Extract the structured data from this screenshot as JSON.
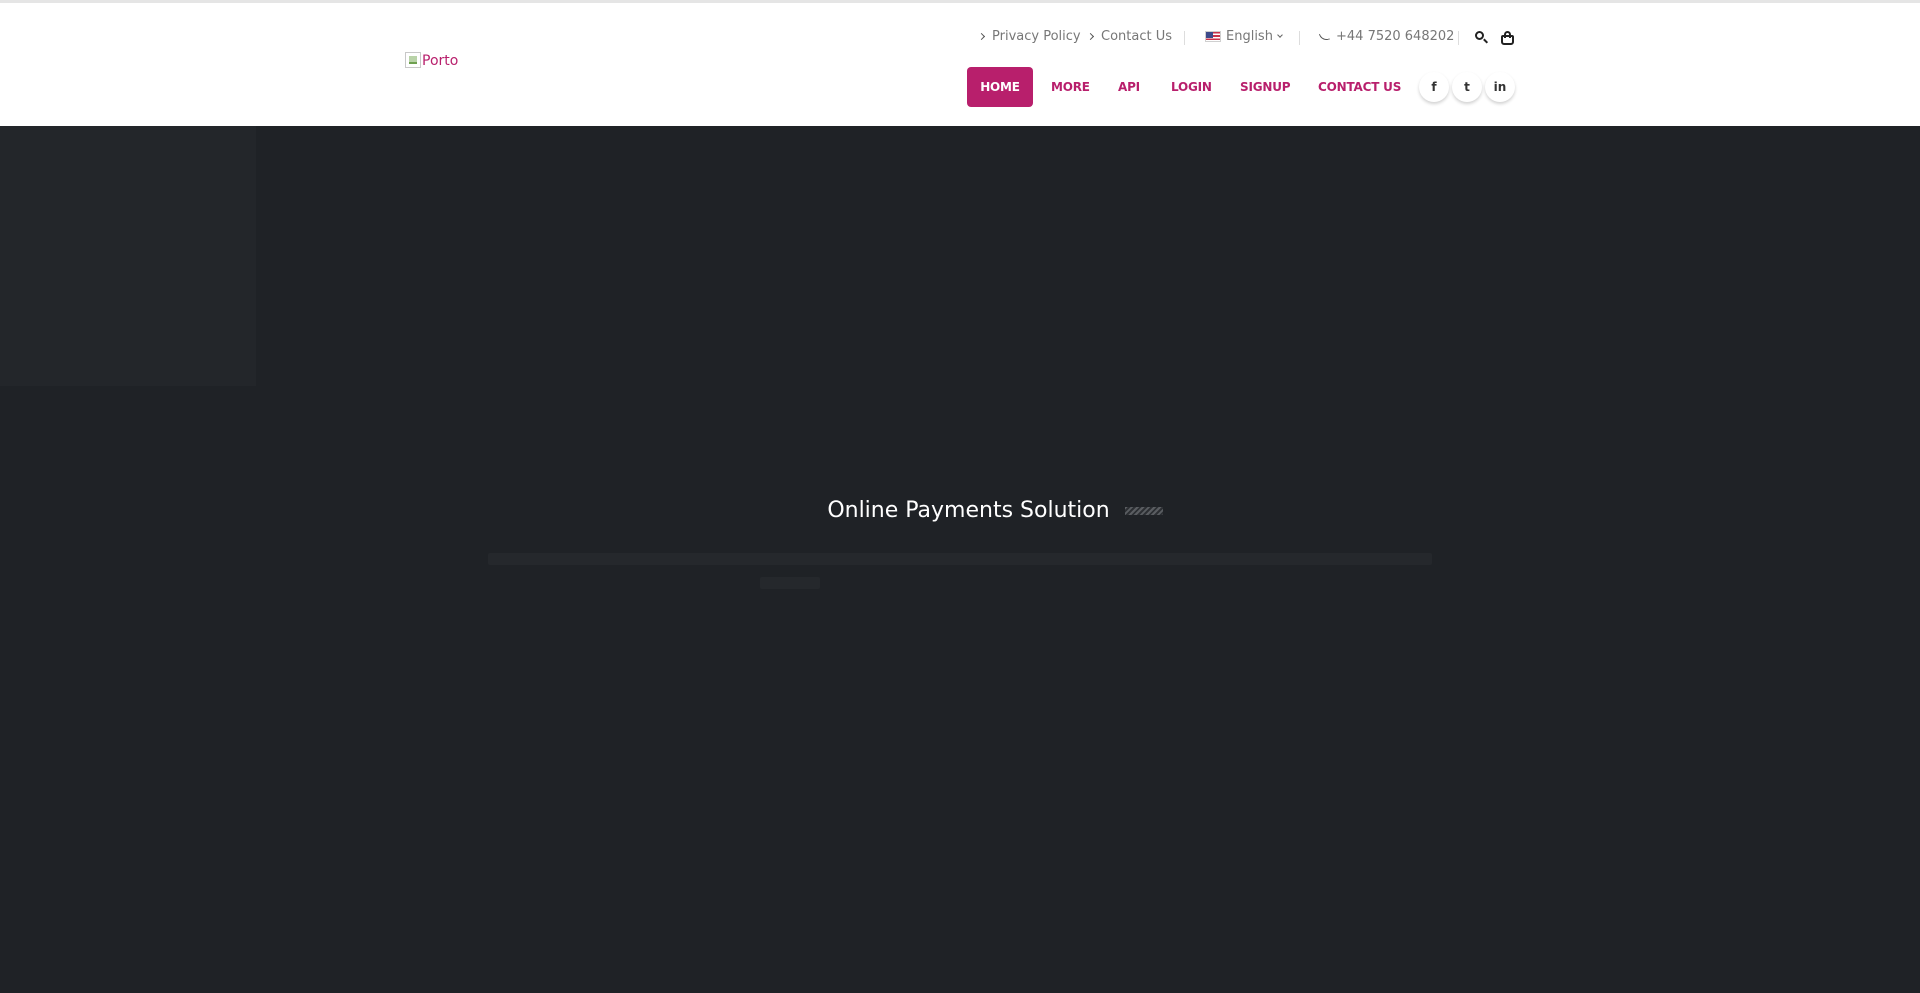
{
  "logo": {
    "alt_text": "Porto"
  },
  "topbar": {
    "privacy_link": "Privacy Policy",
    "contact_link": "Contact Us",
    "language": "English",
    "phone": "+44 7520 648202"
  },
  "nav": {
    "home": "HOME",
    "more": "MORE",
    "api": "API",
    "login": "LOGIN",
    "signup": "SIGNUP",
    "contact": "CONTACT US"
  },
  "social": {
    "facebook": "f",
    "twitter": "t",
    "linkedin": "in"
  },
  "hero": {
    "title": "Online Payments Solution"
  },
  "colors": {
    "accent": "#b81f6c",
    "hero_bg": "#1f2226",
    "header_bg": "#ffffff"
  }
}
